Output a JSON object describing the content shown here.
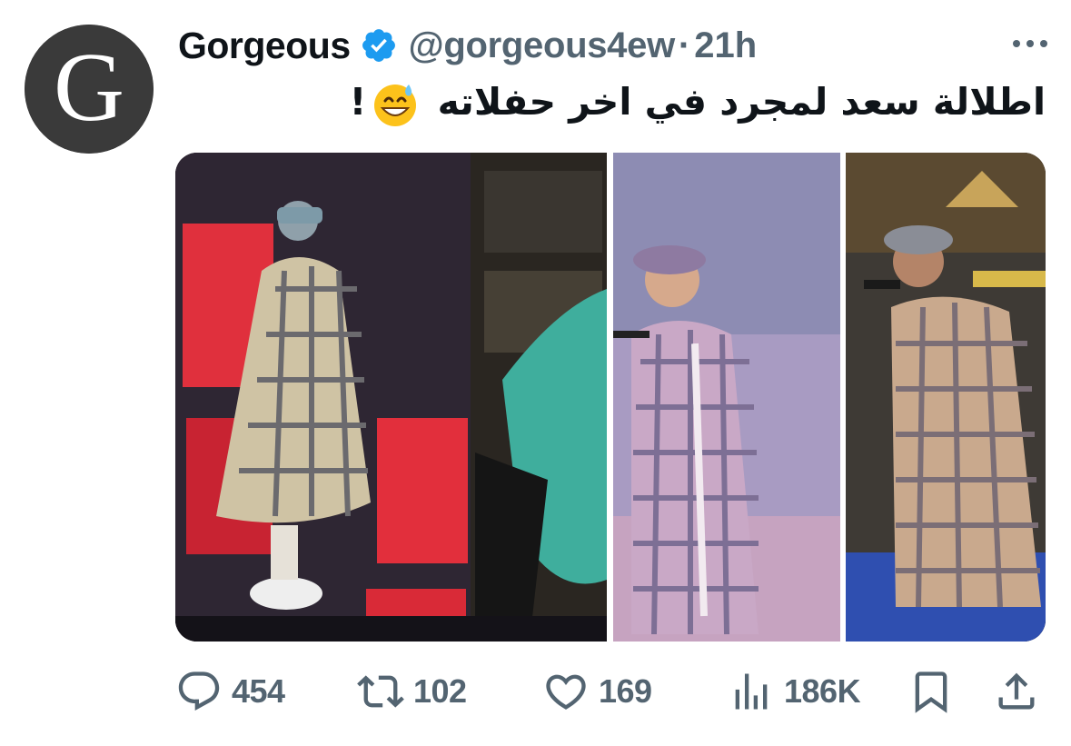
{
  "author": {
    "avatar_letter": "G",
    "display_name": "Gorgeous",
    "verified_icon": "verified-badge-icon",
    "handle": "@gorgeous4ew",
    "separator": "·",
    "timestamp": "21h"
  },
  "tweet": {
    "text": "اطلالة سعد لمجرد في اخر حفلاته",
    "emoji": "grinning-face-with-sweat-emoji",
    "trailing_punctuation": "!"
  },
  "media": {
    "photos": [
      {
        "description_icon": "concert-photo-1"
      },
      {
        "description_icon": "concert-photo-2"
      },
      {
        "description_icon": "concert-photo-3"
      }
    ]
  },
  "actions": {
    "replies": {
      "icon": "reply-icon",
      "count": "454"
    },
    "retweets": {
      "icon": "retweet-icon",
      "count": "102"
    },
    "likes": {
      "icon": "heart-icon",
      "count": "169"
    },
    "views": {
      "icon": "views-icon",
      "count": "186K"
    },
    "bookmark": {
      "icon": "bookmark-icon"
    },
    "share": {
      "icon": "share-icon"
    }
  },
  "colors": {
    "text_primary": "#0f1419",
    "text_secondary": "#536471",
    "verified_blue": "#1d9bf0"
  }
}
